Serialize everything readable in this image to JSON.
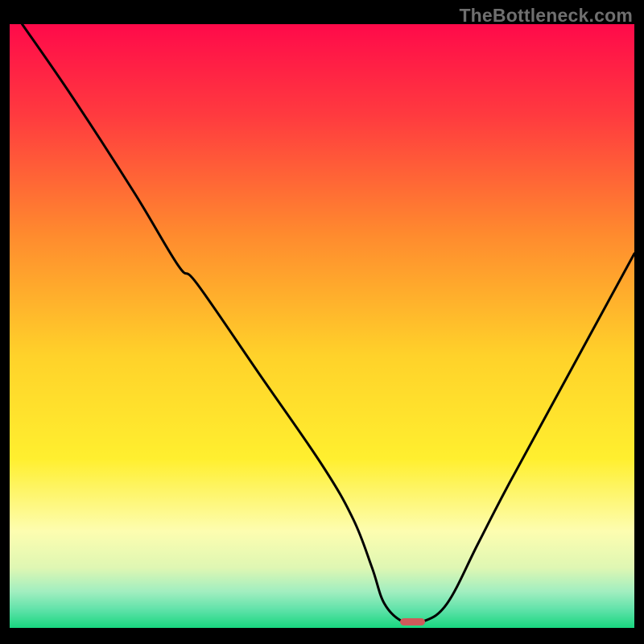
{
  "watermark": "TheBottleneck.com",
  "chart_data": {
    "type": "line",
    "title": "",
    "xlabel": "",
    "ylabel": "",
    "xlim": [
      0,
      100
    ],
    "ylim": [
      0,
      100
    ],
    "series": [
      {
        "name": "bottleneck-curve",
        "x": [
          2,
          10,
          20,
          27,
          30,
          40,
          50,
          55,
          58,
          60,
          63,
          66,
          70,
          75,
          80,
          90,
          100
        ],
        "values": [
          100,
          88,
          72,
          60,
          57,
          42,
          27,
          18,
          10,
          4,
          1,
          1,
          4,
          14,
          24,
          43,
          62
        ]
      }
    ],
    "marker": {
      "x": 64.5,
      "y": 1,
      "width": 4,
      "height": 1.2
    },
    "gradient_stops": [
      {
        "pos": 0.0,
        "color": "#ff0a4a"
      },
      {
        "pos": 0.15,
        "color": "#ff3a3f"
      },
      {
        "pos": 0.35,
        "color": "#ff8b2e"
      },
      {
        "pos": 0.55,
        "color": "#ffd22a"
      },
      {
        "pos": 0.72,
        "color": "#ffef2f"
      },
      {
        "pos": 0.84,
        "color": "#fdfdb0"
      },
      {
        "pos": 0.9,
        "color": "#dff7b3"
      },
      {
        "pos": 0.94,
        "color": "#a1eec0"
      },
      {
        "pos": 0.97,
        "color": "#5fe2a9"
      },
      {
        "pos": 1.0,
        "color": "#18d67f"
      }
    ]
  }
}
